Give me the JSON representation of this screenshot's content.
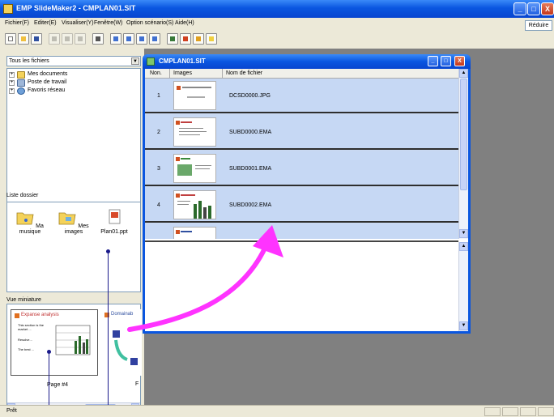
{
  "app": {
    "title": "EMP SlideMaker2 - CMPLAN01.SIT",
    "title_buttons": [
      "_",
      "□",
      "X"
    ]
  },
  "menu": {
    "items": [
      "Fichier(F)",
      "Editer(E)",
      "Visualiser(Y)",
      "Fenêtre(W)",
      "Option scénario(S)",
      "Aide(H)"
    ],
    "reduce_label": "Réduire"
  },
  "toolbar": {
    "buttons": [
      "new-icon",
      "open-icon",
      "save-icon",
      "cut-icon",
      "copy-icon",
      "paste-icon",
      "print-icon",
      "view-large-icon",
      "view-small-icon",
      "view-list-icon",
      "view-details-icon",
      "preview-icon",
      "play-icon",
      "settings-icon",
      "help-icon"
    ]
  },
  "left": {
    "filter_value": "Tous les fichiers",
    "tree": [
      {
        "label": "Mes documents"
      },
      {
        "label": "Poste de travail"
      },
      {
        "label": "Favoris réseau"
      }
    ],
    "folder_section_label": "Liste dossier",
    "folders": [
      {
        "label": "Ma musique"
      },
      {
        "label": "Mes images"
      },
      {
        "label": "Plan01.ppt"
      }
    ],
    "mini_section_label": "Vue miniature",
    "mini_thumb": {
      "title": "Expanse analysis",
      "bullets": [
        "This section is the market ...",
        "Resolve...",
        "The best ..."
      ],
      "caption": "Page #4"
    },
    "mini_thumb2": {
      "title": "Domainab",
      "caption": "F"
    }
  },
  "status": {
    "text": "Prêt"
  },
  "child": {
    "title": "CMPLAN01.SIT",
    "columns": [
      "Non.",
      "Images",
      "Nom de fichier"
    ],
    "rows": [
      {
        "num": "1",
        "file": "DCSD0000.JPG"
      },
      {
        "num": "2",
        "file": "SUBD0000.EMA"
      },
      {
        "num": "3",
        "file": "SUBD0001.EMA"
      },
      {
        "num": "4",
        "file": "SUBD0002.EMA"
      }
    ]
  },
  "colors": {
    "titlebar": "#0a56e0",
    "row_background": "#c6d8f4",
    "arrow": "#ff33ff",
    "callout_line": "#1a1a8a"
  }
}
